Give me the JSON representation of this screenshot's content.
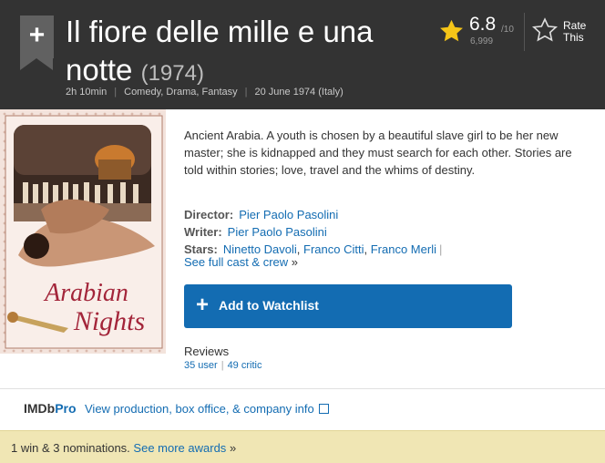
{
  "header": {
    "add_symbol": "+",
    "title": "Il fiore delle mille e una notte",
    "year": "(1974)",
    "runtime": "2h 10min",
    "genres": "Comedy, Drama, Fantasy",
    "release": "20 June 1974 (Italy)",
    "separator": "|"
  },
  "rating": {
    "value": "6.8",
    "out_of": "/10",
    "count": "6,999",
    "rate_label_1": "Rate",
    "rate_label_2": "This",
    "star_color": "#f5c518"
  },
  "poster": {
    "title_line1": "Arabian",
    "title_line2": "Nights"
  },
  "summary": "Ancient Arabia. A youth is chosen by a beautiful slave girl to be her new master; she is kidnapped and they must search for each other. Stories are told within stories; love, travel and the whims of destiny.",
  "credits": {
    "director_label": "Director:",
    "director": "Pier Paolo Pasolini",
    "writer_label": "Writer:",
    "writer": "Pier Paolo Pasolini",
    "stars_label": "Stars:",
    "stars": [
      "Ninetto Davoli",
      "Franco Citti",
      "Franco Merli"
    ],
    "full_cast": "See full cast & crew",
    "full_cast_arrow": "»"
  },
  "watchlist": {
    "icon": "+",
    "label": "Add to Watchlist"
  },
  "reviews": {
    "label": "Reviews",
    "user": "35 user",
    "critic": "49 critic"
  },
  "pro": {
    "logo_imdb": "IMDb",
    "logo_pro": "Pro",
    "link": "View production, box office, & company info"
  },
  "awards": {
    "text": "1 win & 3 nominations.",
    "link": "See more awards",
    "arrow": "»"
  },
  "colors": {
    "header_bg": "#333333",
    "link": "#136cb2",
    "awards_bg": "#f0e6b4"
  }
}
